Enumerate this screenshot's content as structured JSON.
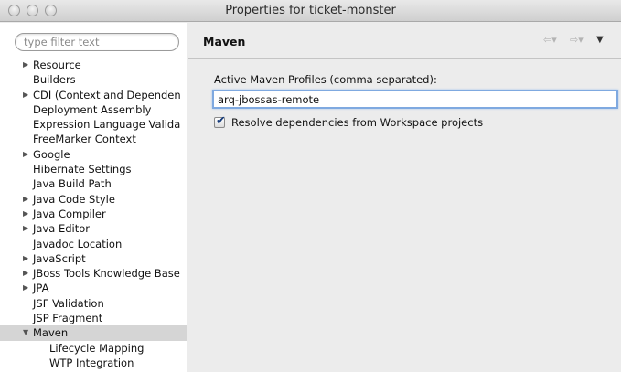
{
  "window": {
    "title": "Properties for ticket-monster"
  },
  "left": {
    "filter_placeholder": "type filter text",
    "items": [
      {
        "label": "Resource",
        "expandable": true
      },
      {
        "label": "Builders",
        "expandable": false
      },
      {
        "label": "CDI (Context and Dependen",
        "expandable": true
      },
      {
        "label": "Deployment Assembly",
        "expandable": false
      },
      {
        "label": "Expression Language Valida",
        "expandable": false
      },
      {
        "label": "FreeMarker Context",
        "expandable": false
      },
      {
        "label": "Google",
        "expandable": true
      },
      {
        "label": "Hibernate Settings",
        "expandable": false
      },
      {
        "label": "Java Build Path",
        "expandable": false
      },
      {
        "label": "Java Code Style",
        "expandable": true
      },
      {
        "label": "Java Compiler",
        "expandable": true
      },
      {
        "label": "Java Editor",
        "expandable": true
      },
      {
        "label": "Javadoc Location",
        "expandable": false
      },
      {
        "label": "JavaScript",
        "expandable": true
      },
      {
        "label": "JBoss Tools Knowledge Base",
        "expandable": true
      },
      {
        "label": "JPA",
        "expandable": true
      },
      {
        "label": "JSF Validation",
        "expandable": false
      },
      {
        "label": "JSP Fragment",
        "expandable": false
      },
      {
        "label": "Maven",
        "expandable": true,
        "expanded": true,
        "selected": true
      },
      {
        "label": "Lifecycle Mapping",
        "child": true
      },
      {
        "label": "WTP Integration",
        "child": true
      }
    ]
  },
  "right": {
    "title": "Maven",
    "profiles_label": "Active Maven Profiles (comma separated):",
    "profiles_value": "arq-jbossas-remote",
    "resolve_label": "Resolve dependencies from Workspace projects",
    "resolve_checked": true,
    "nav_back_glyph": "⇦▾",
    "nav_fwd_glyph": "⇨▾",
    "nav_menu_glyph": "▼"
  }
}
